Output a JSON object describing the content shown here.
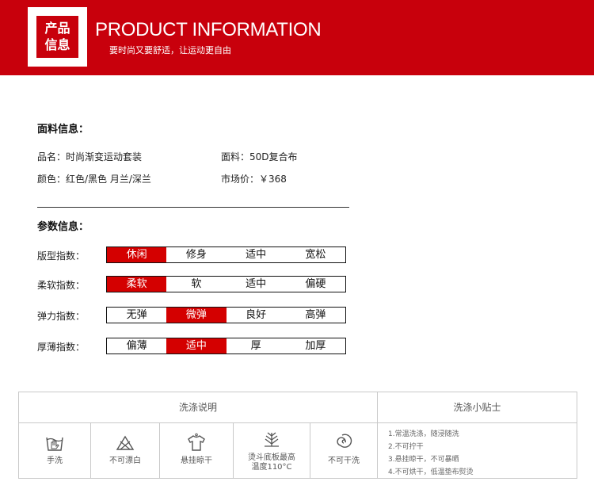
{
  "header": {
    "logo_line1": "产品",
    "logo_line2": "信息",
    "title": "PRODUCT INFORMATION",
    "subtitle": "要时尚又要舒适，让运动更自由"
  },
  "fabric": {
    "title": "面料信息：",
    "name_label": "品名：时尚渐变运动套装",
    "material_label": "面料：50D复合布",
    "color_label": "颜色：红色/黑色  月兰/深兰",
    "price_label": "市场价：￥368"
  },
  "params": {
    "title": "参数信息：",
    "rows": [
      {
        "label": "版型指数：",
        "options": [
          "休闲",
          "修身",
          "适中",
          "宽松"
        ],
        "selected": "休闲"
      },
      {
        "label": "柔软指数：",
        "options": [
          "柔软",
          "软",
          "适中",
          "偏硬"
        ],
        "selected": "柔软"
      },
      {
        "label": "弹力指数：",
        "options": [
          "无弹",
          "微弹",
          "良好",
          "高弹"
        ],
        "selected": "微弹"
      },
      {
        "label": "厚薄指数：",
        "options": [
          "偏薄",
          "适中",
          "厚",
          "加厚"
        ],
        "selected": "适中"
      }
    ]
  },
  "wash": {
    "header_left": "洗涤说明",
    "header_right": "洗涤小贴士",
    "items": [
      {
        "icon": "hand-wash-icon",
        "label": "手洗"
      },
      {
        "icon": "no-bleach-icon",
        "label": "不可漂白"
      },
      {
        "icon": "hang-dry-icon",
        "label": "悬挂晾干"
      },
      {
        "icon": "iron-icon",
        "label_line1": "烫斗底板最高",
        "label_line2": "温度110°C"
      },
      {
        "icon": "no-dry-clean-icon",
        "label": "不可干洗"
      }
    ],
    "tips": [
      "1.常温洗涤，随浸随洗",
      "2.不可拧干",
      "3.悬挂晾干，不可暴晒",
      "4.不可烘干，低温垫布熨烫"
    ]
  },
  "colors": {
    "brand_red": "#c8000c",
    "active_red": "#d40000"
  }
}
